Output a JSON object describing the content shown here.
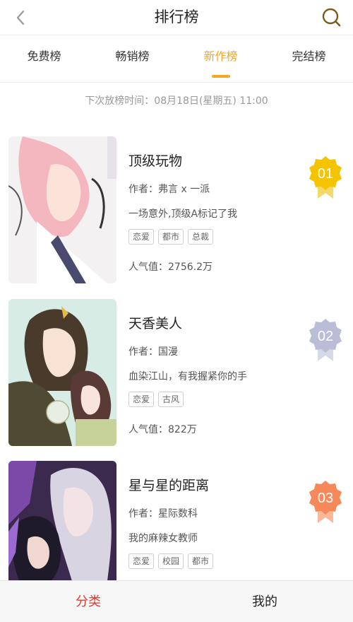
{
  "header": {
    "title": "排行榜",
    "back_icon": "chevron-left-icon",
    "search_icon": "search-icon"
  },
  "tabs": [
    {
      "label": "免费榜",
      "active": false
    },
    {
      "label": "畅销榜",
      "active": false
    },
    {
      "label": "新作榜",
      "active": true
    },
    {
      "label": "完结榜",
      "active": false
    }
  ],
  "accent_color": "#f5a623",
  "notice": "下次放榜时间：08月18日(星期五) 11:00",
  "items": [
    {
      "rank": "01",
      "name": "顶级玩物",
      "author": "作者：弗言 x 一派",
      "desc": "一场意外,顶级A标记了我",
      "tags": [
        "恋爱",
        "都市",
        "总裁"
      ],
      "popularity": "人气值：2756.2万",
      "badge_color": "#f5c400"
    },
    {
      "rank": "02",
      "name": "天香美人",
      "author": "作者：国漫",
      "desc": "血染江山，有我握紧你的手",
      "tags": [
        "恋爱",
        "古风"
      ],
      "popularity": "人气值：822万",
      "badge_color": "#b9bed6"
    },
    {
      "rank": "03",
      "name": "星与星的距离",
      "author": "作者：星际数科",
      "desc": "我的麻辣女教师",
      "tags": [
        "恋爱",
        "校园",
        "都市"
      ],
      "popularity": "",
      "badge_color": "#f7885a"
    }
  ],
  "bottom_nav": {
    "category": "分类",
    "mine": "我的"
  }
}
